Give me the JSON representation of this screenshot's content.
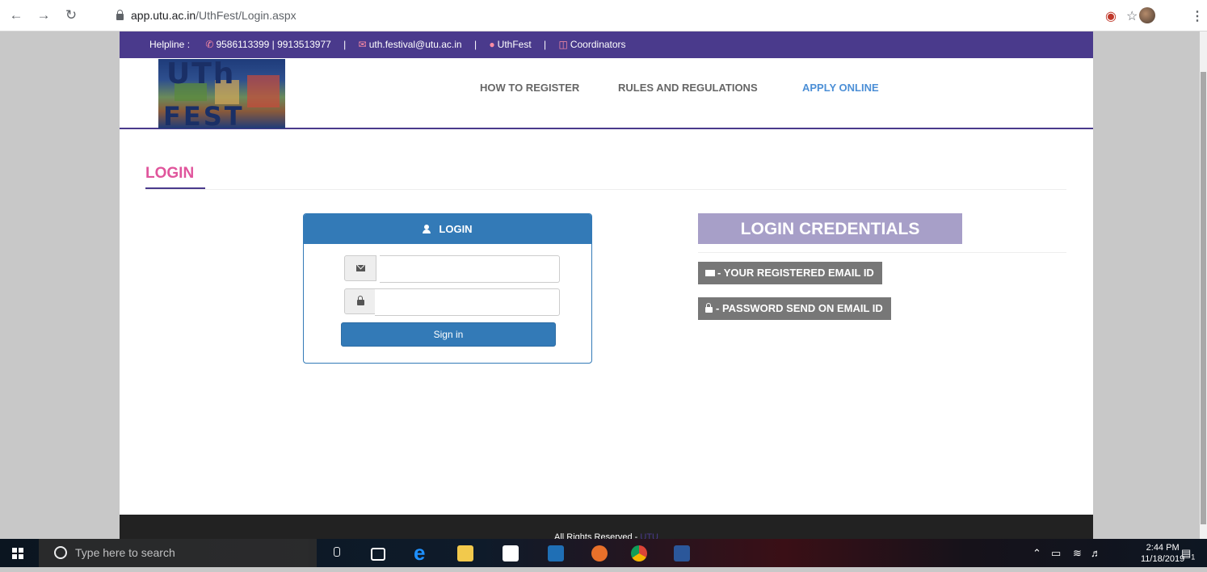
{
  "browser": {
    "url_host": "app.utu.ac.in",
    "url_path": "/UthFest/Login.aspx"
  },
  "helpline": {
    "label": "Helpline :",
    "phones": "9586113399 | 9913513977",
    "email": "uth.festival@utu.ac.in",
    "fest": "UthFest",
    "coordinators": "Coordinators",
    "separator": "|"
  },
  "logo": {
    "line1": "UTh",
    "line2": "FEST"
  },
  "nav": {
    "how_to_register": "HOW TO REGISTER",
    "rules": "RULES AND REGULATIONS",
    "apply": "APPLY ONLINE"
  },
  "page": {
    "title": "LOGIN"
  },
  "login_panel": {
    "heading": "LOGIN",
    "email_value": "",
    "password_value": "",
    "signin_label": "Sign in"
  },
  "credentials": {
    "heading": "LOGIN CREDENTIALS",
    "email_hint": "- YOUR REGISTERED EMAIL ID",
    "password_hint": "- PASSWORD SEND ON EMAIL ID"
  },
  "footer": {
    "text": "All Rights Reserved - ",
    "brand": "UTU"
  },
  "taskbar": {
    "search_placeholder": "Type here to search",
    "time": "2:44 PM",
    "date": "11/18/2019",
    "notification_count": "1"
  },
  "colors": {
    "brand_purple": "#4a3a8c",
    "primary_blue": "#337ab7",
    "title_pink": "#e0559c",
    "credentials_lavender": "#a79fc8",
    "active_nav": "#4c8fd6"
  }
}
